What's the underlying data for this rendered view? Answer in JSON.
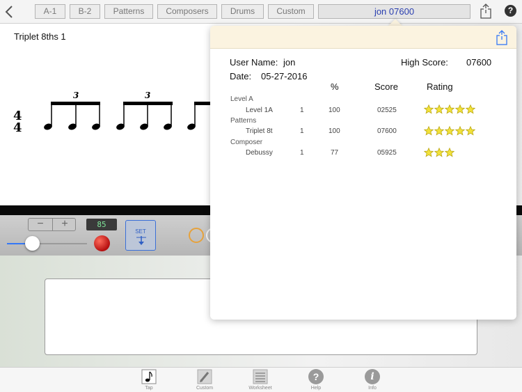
{
  "toolbar": {
    "tabs": [
      {
        "label": "A-1"
      },
      {
        "label": "B-2"
      },
      {
        "label": "Patterns"
      },
      {
        "label": "Composers"
      },
      {
        "label": "Drums"
      },
      {
        "label": "Custom"
      }
    ],
    "user_button": "jon 07600",
    "help_label": "?"
  },
  "score": {
    "title": "Triplet 8ths 1",
    "time_sig_top": "4",
    "time_sig_bottom": "4",
    "tuplet_label": "3"
  },
  "controls": {
    "stepper_minus": "−",
    "stepper_plus": "+",
    "tempo": "85",
    "slider_value": 0.3,
    "set_label": "SET"
  },
  "tabbar": [
    {
      "label": "Tap",
      "icon": "note-icon"
    },
    {
      "label": "Custom",
      "icon": "pencil-icon"
    },
    {
      "label": "Worksheet",
      "icon": "list-icon"
    },
    {
      "label": "Help",
      "icon": "help-icon",
      "glyph": "?"
    },
    {
      "label": "Info",
      "icon": "info-icon",
      "glyph": "i"
    }
  ],
  "stats": {
    "user_name_label": "User Name:",
    "user_name": "jon",
    "high_score_label": "High Score:",
    "high_score": "07600",
    "date_label": "Date:",
    "date": "05-27-2016",
    "columns": {
      "percent": "%",
      "score": "Score",
      "rating": "Rating"
    },
    "groups": [
      {
        "category": "Level A",
        "name": "Level 1A",
        "attempts": "1",
        "percent": "100",
        "score": "02525",
        "stars": 5
      },
      {
        "category": "Patterns",
        "name": "Triplet 8t",
        "attempts": "1",
        "percent": "100",
        "score": "07600",
        "stars": 5
      },
      {
        "category": "Composer",
        "name": "Debussy",
        "attempts": "1",
        "percent": "77",
        "score": "05925",
        "stars": 3
      }
    ]
  },
  "colors": {
    "accent": "#2a3fb0",
    "star": "#f2e23a",
    "popover_header": "#fbf3e0",
    "record": "#c41a1a"
  }
}
